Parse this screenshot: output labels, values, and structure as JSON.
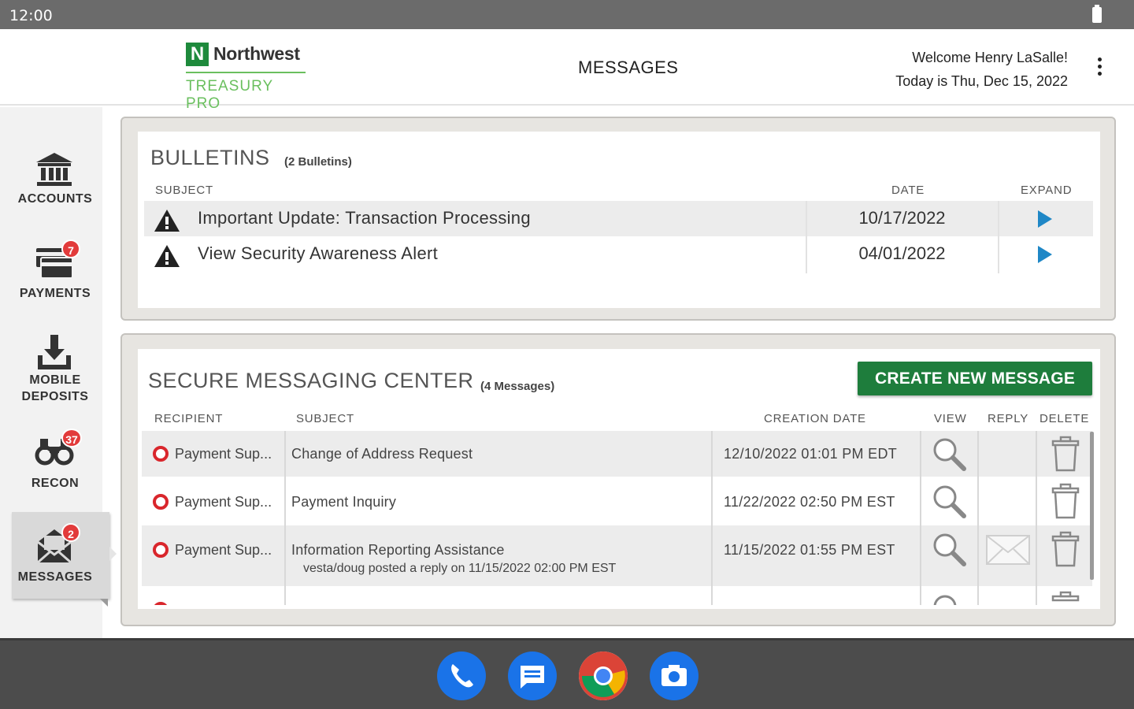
{
  "status_bar": {
    "time": "12:00"
  },
  "header": {
    "logo_letter": "N",
    "logo_name": "Northwest",
    "logo_product": "TREASURY PRO",
    "title": "MESSAGES",
    "welcome": "Welcome Henry LaSalle!",
    "today": "Today is Thu, Dec 15, 2022"
  },
  "sidebar": {
    "items": [
      {
        "label": "ACCOUNTS",
        "icon": "bank-icon",
        "badge": ""
      },
      {
        "label": "PAYMENTS",
        "icon": "payments-icon",
        "badge": "7"
      },
      {
        "label_line1": "MOBILE",
        "label_line2": "DEPOSITS",
        "icon": "mobile-deposit-icon",
        "badge": ""
      },
      {
        "label": "RECON",
        "icon": "binoculars-icon",
        "badge": "37"
      },
      {
        "label": "MESSAGES",
        "icon": "envelope-icon",
        "badge": "2"
      }
    ]
  },
  "bulletins": {
    "title": "BULLETINS",
    "count": "(2 Bulletins)",
    "columns": {
      "subject": "SUBJECT",
      "date": "DATE",
      "expand": "EXPAND"
    },
    "rows": [
      {
        "subject": "Important Update: Transaction Processing",
        "date": "10/17/2022"
      },
      {
        "subject": "View Security Awareness Alert",
        "date": "04/01/2022"
      }
    ]
  },
  "messaging": {
    "title": "SECURE MESSAGING CENTER",
    "count": "(4 Messages)",
    "create_button": "CREATE NEW MESSAGE",
    "columns": {
      "recipient": "RECIPIENT",
      "subject": "SUBJECT",
      "creation_date": "CREATION DATE",
      "view": "VIEW",
      "reply": "REPLY",
      "delete": "DELETE"
    },
    "rows": [
      {
        "recipient": "Payment Sup...",
        "subject": "Change of Address Request",
        "date": "12/10/2022 01:01 PM EDT",
        "note": ""
      },
      {
        "recipient": "Payment Sup...",
        "subject": "Payment Inquiry",
        "date": "11/22/2022 02:50 PM EST",
        "note": ""
      },
      {
        "recipient": "Payment Sup...",
        "subject": "Information Reporting Assistance",
        "date": "11/15/2022 01:55 PM EST",
        "note": "vesta/doug posted a reply on 11/15/2022 02:00 PM EST"
      }
    ]
  },
  "colors": {
    "brand_green": "#1e7d3c",
    "logo_light_green": "#6abf5e",
    "badge_red": "#e23b3b",
    "expand_blue": "#1f87c6",
    "status_red": "#d9262c"
  },
  "dock": {
    "apps": [
      "phone-icon",
      "messages-icon",
      "chrome-icon",
      "camera-icon"
    ]
  }
}
